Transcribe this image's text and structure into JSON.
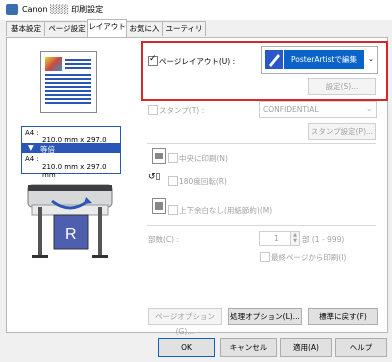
{
  "window": {
    "title": "Canon ░░░ 印刷設定"
  },
  "tabs": [
    "基本設定",
    "ページ設定",
    "レイアウト",
    "お気に入り",
    "ユーティリティ"
  ],
  "active_tab": 2,
  "left": {
    "size_a": "A4 :",
    "size_a_dim": "210.0 mm x 297.0 mm",
    "scale": "等倍",
    "size_b": "A4 :",
    "size_b_dim": "210.0 mm x 297.0 mm"
  },
  "page_layout": {
    "label": "ページレイアウト(U) :",
    "value": "PosterArtistで編集",
    "checked": true,
    "settings_btn": "設定(S)..."
  },
  "stamp": {
    "label": "スタンプ(T) :",
    "value": "CONFIDENTIAL",
    "btn": "スタンプ設定(P)..."
  },
  "options": [
    {
      "label": "中央に印刷(N)"
    },
    {
      "label": "180度回転(R)"
    },
    {
      "label": "上下余白なし(用紙節約)(M)"
    }
  ],
  "copies": {
    "label": "部数(C) :",
    "value": "1",
    "range": "部 (1 - 999)",
    "last_page": "最終ページから印刷(I)"
  },
  "bottom_panel_btns": [
    "ページオプション(G)...",
    "処理オプション(L)...",
    "標準に戻す(F)"
  ],
  "dialog_btns": [
    "OK",
    "キャンセル",
    "適用(A)",
    "ヘルプ"
  ]
}
